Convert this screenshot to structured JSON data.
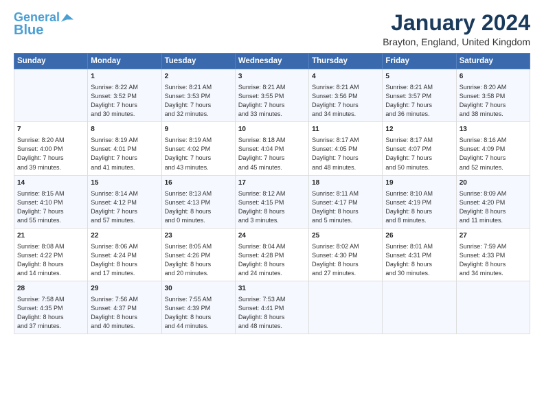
{
  "logo": {
    "line1": "General",
    "line2": "Blue",
    "arrow_color": "#4a9fd4"
  },
  "title": "January 2024",
  "subtitle": "Brayton, England, United Kingdom",
  "days_header": [
    "Sunday",
    "Monday",
    "Tuesday",
    "Wednesday",
    "Thursday",
    "Friday",
    "Saturday"
  ],
  "weeks": [
    {
      "cells": [
        {
          "day": "",
          "content": ""
        },
        {
          "day": "1",
          "content": "Sunrise: 8:22 AM\nSunset: 3:52 PM\nDaylight: 7 hours\nand 30 minutes."
        },
        {
          "day": "2",
          "content": "Sunrise: 8:21 AM\nSunset: 3:53 PM\nDaylight: 7 hours\nand 32 minutes."
        },
        {
          "day": "3",
          "content": "Sunrise: 8:21 AM\nSunset: 3:55 PM\nDaylight: 7 hours\nand 33 minutes."
        },
        {
          "day": "4",
          "content": "Sunrise: 8:21 AM\nSunset: 3:56 PM\nDaylight: 7 hours\nand 34 minutes."
        },
        {
          "day": "5",
          "content": "Sunrise: 8:21 AM\nSunset: 3:57 PM\nDaylight: 7 hours\nand 36 minutes."
        },
        {
          "day": "6",
          "content": "Sunrise: 8:20 AM\nSunset: 3:58 PM\nDaylight: 7 hours\nand 38 minutes."
        }
      ]
    },
    {
      "cells": [
        {
          "day": "7",
          "content": "Sunrise: 8:20 AM\nSunset: 4:00 PM\nDaylight: 7 hours\nand 39 minutes."
        },
        {
          "day": "8",
          "content": "Sunrise: 8:19 AM\nSunset: 4:01 PM\nDaylight: 7 hours\nand 41 minutes."
        },
        {
          "day": "9",
          "content": "Sunrise: 8:19 AM\nSunset: 4:02 PM\nDaylight: 7 hours\nand 43 minutes."
        },
        {
          "day": "10",
          "content": "Sunrise: 8:18 AM\nSunset: 4:04 PM\nDaylight: 7 hours\nand 45 minutes."
        },
        {
          "day": "11",
          "content": "Sunrise: 8:17 AM\nSunset: 4:05 PM\nDaylight: 7 hours\nand 48 minutes."
        },
        {
          "day": "12",
          "content": "Sunrise: 8:17 AM\nSunset: 4:07 PM\nDaylight: 7 hours\nand 50 minutes."
        },
        {
          "day": "13",
          "content": "Sunrise: 8:16 AM\nSunset: 4:09 PM\nDaylight: 7 hours\nand 52 minutes."
        }
      ]
    },
    {
      "cells": [
        {
          "day": "14",
          "content": "Sunrise: 8:15 AM\nSunset: 4:10 PM\nDaylight: 7 hours\nand 55 minutes."
        },
        {
          "day": "15",
          "content": "Sunrise: 8:14 AM\nSunset: 4:12 PM\nDaylight: 7 hours\nand 57 minutes."
        },
        {
          "day": "16",
          "content": "Sunrise: 8:13 AM\nSunset: 4:13 PM\nDaylight: 8 hours\nand 0 minutes."
        },
        {
          "day": "17",
          "content": "Sunrise: 8:12 AM\nSunset: 4:15 PM\nDaylight: 8 hours\nand 3 minutes."
        },
        {
          "day": "18",
          "content": "Sunrise: 8:11 AM\nSunset: 4:17 PM\nDaylight: 8 hours\nand 5 minutes."
        },
        {
          "day": "19",
          "content": "Sunrise: 8:10 AM\nSunset: 4:19 PM\nDaylight: 8 hours\nand 8 minutes."
        },
        {
          "day": "20",
          "content": "Sunrise: 8:09 AM\nSunset: 4:20 PM\nDaylight: 8 hours\nand 11 minutes."
        }
      ]
    },
    {
      "cells": [
        {
          "day": "21",
          "content": "Sunrise: 8:08 AM\nSunset: 4:22 PM\nDaylight: 8 hours\nand 14 minutes."
        },
        {
          "day": "22",
          "content": "Sunrise: 8:06 AM\nSunset: 4:24 PM\nDaylight: 8 hours\nand 17 minutes."
        },
        {
          "day": "23",
          "content": "Sunrise: 8:05 AM\nSunset: 4:26 PM\nDaylight: 8 hours\nand 20 minutes."
        },
        {
          "day": "24",
          "content": "Sunrise: 8:04 AM\nSunset: 4:28 PM\nDaylight: 8 hours\nand 24 minutes."
        },
        {
          "day": "25",
          "content": "Sunrise: 8:02 AM\nSunset: 4:30 PM\nDaylight: 8 hours\nand 27 minutes."
        },
        {
          "day": "26",
          "content": "Sunrise: 8:01 AM\nSunset: 4:31 PM\nDaylight: 8 hours\nand 30 minutes."
        },
        {
          "day": "27",
          "content": "Sunrise: 7:59 AM\nSunset: 4:33 PM\nDaylight: 8 hours\nand 34 minutes."
        }
      ]
    },
    {
      "cells": [
        {
          "day": "28",
          "content": "Sunrise: 7:58 AM\nSunset: 4:35 PM\nDaylight: 8 hours\nand 37 minutes."
        },
        {
          "day": "29",
          "content": "Sunrise: 7:56 AM\nSunset: 4:37 PM\nDaylight: 8 hours\nand 40 minutes."
        },
        {
          "day": "30",
          "content": "Sunrise: 7:55 AM\nSunset: 4:39 PM\nDaylight: 8 hours\nand 44 minutes."
        },
        {
          "day": "31",
          "content": "Sunrise: 7:53 AM\nSunset: 4:41 PM\nDaylight: 8 hours\nand 48 minutes."
        },
        {
          "day": "",
          "content": ""
        },
        {
          "day": "",
          "content": ""
        },
        {
          "day": "",
          "content": ""
        }
      ]
    }
  ]
}
